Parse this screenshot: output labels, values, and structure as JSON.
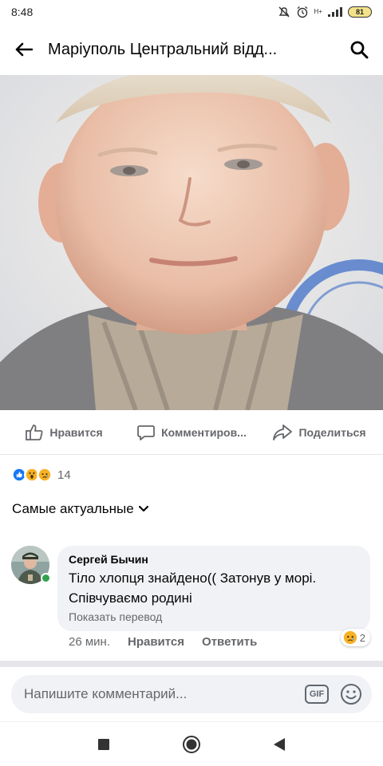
{
  "status_bar": {
    "time": "8:48",
    "network_text": "Н+",
    "battery": "81"
  },
  "header": {
    "title": "Маріуполь Центральний відд..."
  },
  "post": {
    "actions": {
      "like": "Нравится",
      "comment": "Комментиров...",
      "share": "Поделиться"
    },
    "reactions": {
      "icons": [
        "like-reaction",
        "wow-reaction",
        "sad-reaction"
      ],
      "count": "14"
    }
  },
  "comments_section": {
    "sort_label": "Самые актуальные",
    "comments": [
      {
        "author": "Сергей Бычин",
        "text": "Тіло хлопця знайдено(( Затонув у морі. Співчуваємо родині",
        "translate_link": "Показать перевод",
        "time": "26 мин.",
        "like_label": "Нравится",
        "reply_label": "Ответить",
        "reaction_icon": "sad-reaction",
        "reaction_count": "2"
      }
    ]
  },
  "composer": {
    "placeholder": "Напишите комментарий...",
    "gif_label": "GIF"
  },
  "colors": {
    "primary_text": "#050505",
    "secondary_text": "#65676b",
    "bubble_bg": "#f0f2f5",
    "like_blue": "#1877f2",
    "reaction_yellow": "#f7b125",
    "online_green": "#31a24c"
  }
}
